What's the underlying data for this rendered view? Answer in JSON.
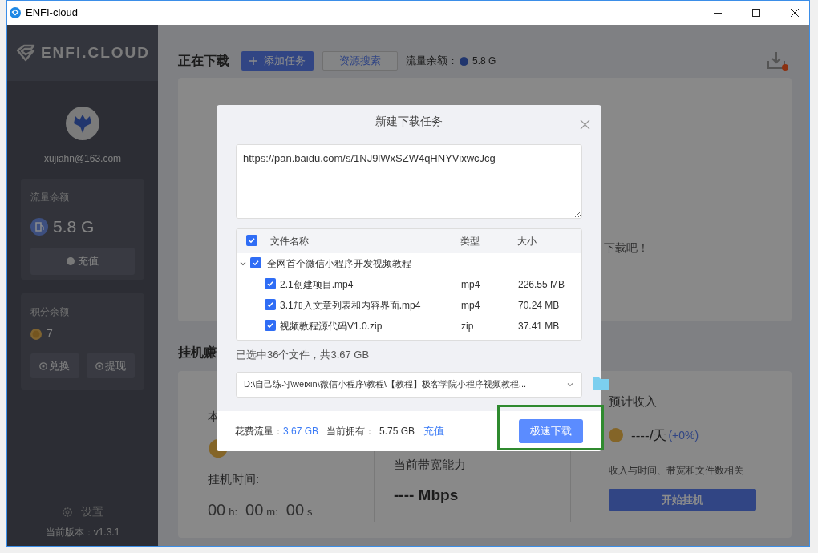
{
  "window": {
    "title": "ENFI-cloud"
  },
  "sidebar": {
    "logo": "ENFI.CLOUD",
    "email": "xujiahn@163.com",
    "traffic": {
      "label": "流量余额",
      "value": "5.8 G",
      "button": "充值"
    },
    "points": {
      "label": "积分余额",
      "value": "7",
      "buttons": [
        "兑换",
        "提现"
      ]
    },
    "settings": "设置",
    "version": "当前版本：v1.3.1"
  },
  "downloads": {
    "title": "正在下载",
    "add_button": "添加任务",
    "search_button": "资源搜索",
    "balance_label": "流量余额：",
    "balance_value": "5.8 G",
    "empty_text": "下载吧！"
  },
  "earning": {
    "title": "挂机赚",
    "col1_label": "本",
    "time_label": "挂机时间:",
    "time_parts": [
      {
        "num": "00",
        "unit": "h:"
      },
      {
        "num": "00",
        "unit": "m:"
      },
      {
        "num": "00",
        "unit": "s"
      }
    ],
    "bandwidth_label": "当前带宽能力",
    "bandwidth_value": "---- Mbps",
    "income_label": "预计收入",
    "income_value": "----/天",
    "income_change": "(+0%)",
    "income_note": "收入与时间、带宽和文件数相关",
    "start_button": "开始挂机"
  },
  "dialog": {
    "title": "新建下载任务",
    "url": "https://pan.baidu.com/s/1NJ9lWxSZW4qHNYVixwcJcg",
    "columns": [
      "文件名称",
      "类型",
      "大小"
    ],
    "all_checked": true,
    "tree": [
      {
        "name": "全网首个微信小程序开发视频教程",
        "checked": true,
        "expanded": true,
        "children": [
          {
            "name": "2.1创建项目.mp4",
            "type": "mp4",
            "size": "226.55 MB",
            "checked": true
          },
          {
            "name": "3.1加入文章列表和内容界面.mp4",
            "type": "mp4",
            "size": "70.24 MB",
            "checked": true
          },
          {
            "name": "视频教程源代码V1.0.zip",
            "type": "zip",
            "size": "37.41 MB",
            "checked": true
          }
        ]
      }
    ],
    "summary": "已选中36个文件，共3.67 GB",
    "path": "D:\\自己练习\\weixin\\微信小程序\\教程\\【教程】极客学院小程序视频教程...",
    "cost_label": "花费流量：",
    "cost_value": "3.67 GB",
    "own_label": "当前拥有：",
    "own_value": "5.75 GB",
    "recharge_link": "充值",
    "download_button": "极速下载"
  }
}
